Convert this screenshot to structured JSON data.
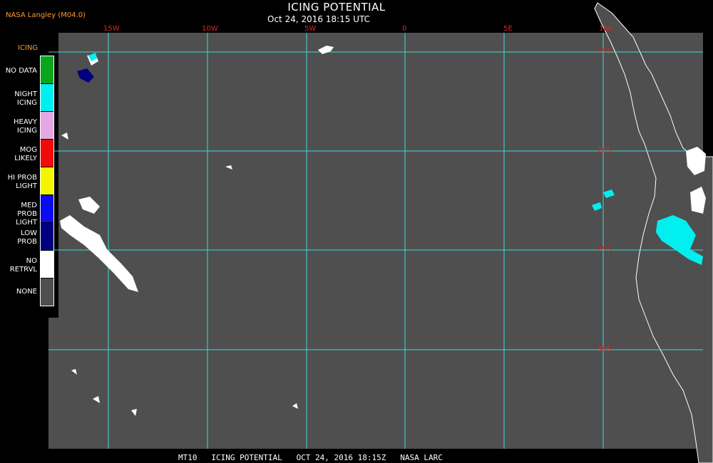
{
  "header": {
    "title": "ICING POTENTIAL",
    "subtitle": "Oct 24, 2016 18:15 UTC",
    "credit": "NASA Langley (M04.0)"
  },
  "legend": {
    "title": "ICING",
    "items": [
      {
        "line1": "NO DATA",
        "line2": "",
        "color": "#0aa51e"
      },
      {
        "line1": "NIGHT",
        "line2": "ICING",
        "color": "#00f0f0"
      },
      {
        "line1": "HEAVY",
        "line2": "ICING",
        "color": "#e6a7e6"
      },
      {
        "line1": "MOG",
        "line2": "LIKELY",
        "color": "#f00a0a"
      },
      {
        "line1": "HI PROB",
        "line2": "LIGHT",
        "color": "#f5f500"
      },
      {
        "line1": "MED PROB",
        "line2": "LIGHT",
        "color": "#0a0af5"
      },
      {
        "line1": "LOW",
        "line2": "PROB",
        "color": "#000080"
      },
      {
        "line1": "NO",
        "line2": "RETRVL",
        "color": "#ffffff"
      },
      {
        "line1": "NONE",
        "line2": "",
        "color": "#4f4f4f"
      }
    ]
  },
  "grid": {
    "longitude_labels": [
      "15W",
      "10W",
      "5W",
      "0",
      "5E",
      "10E"
    ],
    "latitude_labels": [
      "15S",
      "20S",
      "25S",
      "30S"
    ],
    "line_color": "#3fd9d9",
    "label_color": "#d42a2a"
  },
  "map": {
    "background_color": "#4f4f4f",
    "coastline_color": "#ffffff"
  },
  "footer": {
    "text": "MT10   ICING POTENTIAL   OCT 24, 2016 18:15Z   NASA LARC"
  }
}
